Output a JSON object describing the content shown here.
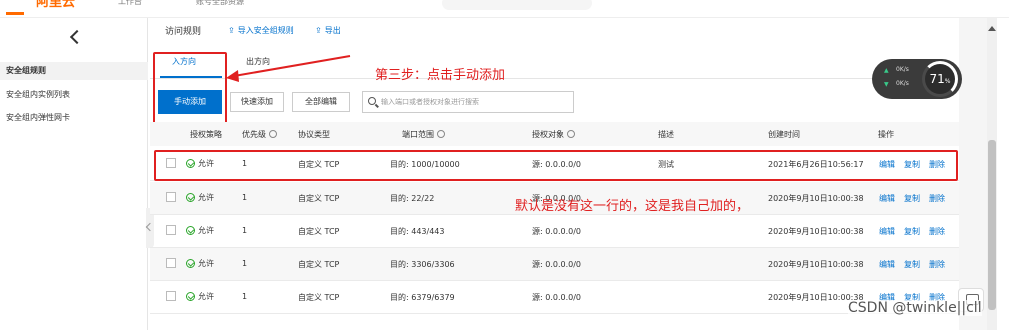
{
  "topbar": {
    "brand": "阿里云",
    "workbench": "工作台",
    "account": "账号全部资源"
  },
  "sidebar": {
    "items": [
      {
        "label": "安全组规则",
        "active": true
      },
      {
        "label": "安全组内实例列表",
        "active": false
      },
      {
        "label": "安全组内弹性网卡",
        "active": false
      }
    ]
  },
  "main": {
    "section_title": "访问规则",
    "import_link": "导入安全组规则",
    "export_link": "导出",
    "tabs": [
      "入方向",
      "出方向"
    ],
    "btn_manual_add": "手动添加",
    "btn_quick_add": "快速添加",
    "btn_edit_all": "全部编辑",
    "search_placeholder": "输入端口或者授权对象进行搜索"
  },
  "annotations": {
    "step3": "第三步：点击手动添加",
    "note": "默认是没有这一行的，这是我自己加的，"
  },
  "table": {
    "headers": [
      "授权策略",
      "优先级",
      "协议类型",
      "端口范围",
      "授权对象",
      "描述",
      "创建时间",
      "操作"
    ],
    "rows": [
      {
        "policy": "允许",
        "priority": "1",
        "protocol": "自定义 TCP",
        "port": "目的: 1000/10000",
        "object": "源: 0.0.0.0/0",
        "desc": "测试",
        "time": "2021年6月26日10:56:17",
        "edit": "编辑",
        "copy": "复制",
        "del": "删除"
      },
      {
        "policy": "允许",
        "priority": "1",
        "protocol": "自定义 TCP",
        "port": "目的: 22/22",
        "object": "源: 0.0.0.0/0",
        "desc": "",
        "time": "2020年9月10日10:00:38",
        "edit": "编辑",
        "copy": "复制",
        "del": "删除"
      },
      {
        "policy": "允许",
        "priority": "1",
        "protocol": "自定义 TCP",
        "port": "目的: 443/443",
        "object": "源: 0.0.0.0/0",
        "desc": "",
        "time": "2020年9月10日10:00:38",
        "edit": "编辑",
        "copy": "复制",
        "del": "删除"
      },
      {
        "policy": "允许",
        "priority": "1",
        "protocol": "自定义 TCP",
        "port": "目的: 3306/3306",
        "object": "源: 0.0.0.0/0",
        "desc": "",
        "time": "2020年9月10日10:00:38",
        "edit": "编辑",
        "copy": "复制",
        "del": "删除"
      },
      {
        "policy": "允许",
        "priority": "1",
        "protocol": "自定义 TCP",
        "port": "目的: 6379/6379",
        "object": "源: 0.0.0.0/0",
        "desc": "",
        "time": "2020年9月10日10:00:38",
        "edit": "编辑",
        "copy": "复制",
        "del": "删除"
      }
    ]
  },
  "widget": {
    "up_rate": "0K/s",
    "down_rate": "0K/s",
    "percent": "71",
    "percent_unit": "%"
  },
  "watermark": "CSDN @twinkle||cll",
  "colors": {
    "accent": "#0070cc",
    "brand": "#ff6a00",
    "annotation": "#e02020",
    "allow": "#2aa52a"
  }
}
